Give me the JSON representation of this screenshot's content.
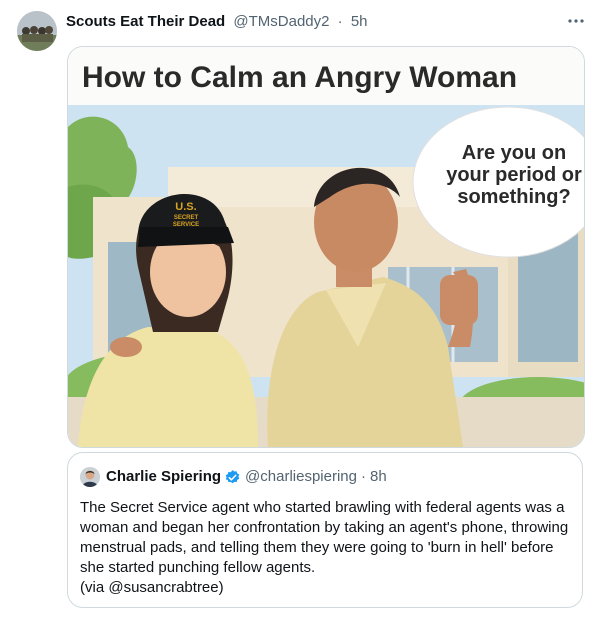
{
  "tweet": {
    "author_name": "Scouts Eat Their Dead",
    "handle": "@TMsDaddy2",
    "separator": "·",
    "time": "5h",
    "more_icon": "more-icon",
    "avatar_icon": "avatar-icon"
  },
  "meme": {
    "title": "How to Calm an Angry Woman",
    "speech_lines": [
      "Are you on",
      "your period or",
      "something?"
    ],
    "cap_line1": "U.S.",
    "cap_line2": "SECRET",
    "cap_line3": "SERVICE"
  },
  "quote": {
    "author_name": "Charlie Spiering",
    "verified_icon": "verified-badge-icon",
    "handle": "@charliespiering",
    "separator": "·",
    "time": "8h",
    "text": "The Secret Service agent who started brawling with federal agents was a woman and began her confrontation by taking an agent's phone, throwing menstrual pads, and telling them they were going to 'burn in hell' before she started punching fellow agents.",
    "via": "(via @susancrabtree)"
  },
  "colors": {
    "verified_blue": "#1d9bf0",
    "secondary_text": "#536471",
    "border": "#cfd9de"
  }
}
